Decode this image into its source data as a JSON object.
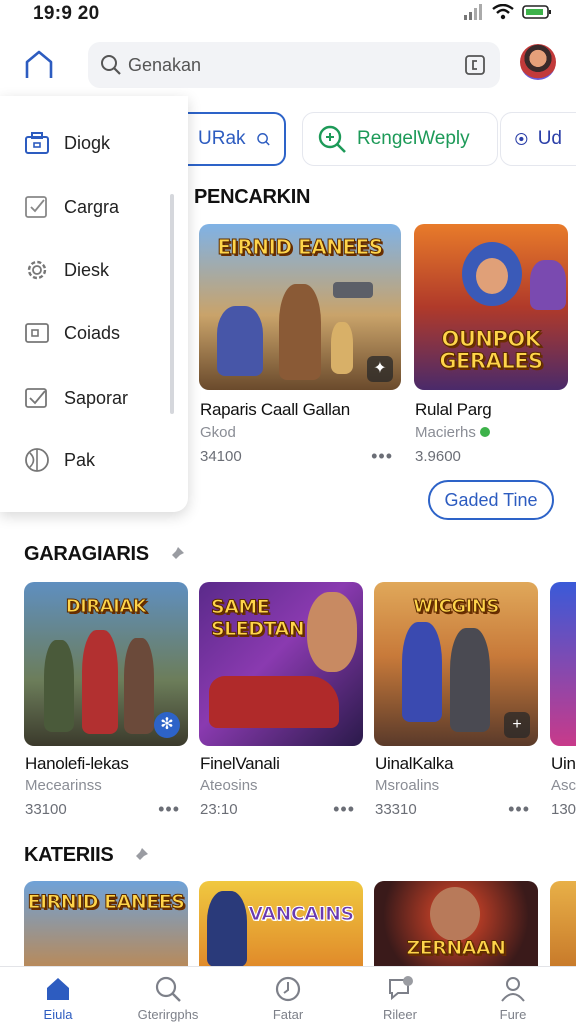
{
  "status_bar": {
    "time": "19:9 20"
  },
  "search": {
    "value": "Genakan"
  },
  "chips": [
    {
      "label": "URak"
    },
    {
      "label": "RengelWeply"
    },
    {
      "label": "Ud"
    }
  ],
  "menu": {
    "items": [
      {
        "label": "Diogk"
      },
      {
        "label": "Cargra"
      },
      {
        "label": "Diesk"
      },
      {
        "label": "Coiads"
      },
      {
        "label": "Saporar"
      },
      {
        "label": "Pak"
      }
    ]
  },
  "sections": {
    "s1": {
      "title": "PENCARKIN",
      "cards": [
        {
          "art": "EIRNID EANEES",
          "name": "Raparis Caall Gallan",
          "sub": "Gkod",
          "count": "34100"
        },
        {
          "art": "OUNPOK GERALES",
          "name": "Rulal Parg",
          "sub": "Macierhs",
          "count": "3.9600"
        }
      ],
      "guided_button": "Gaded Tine"
    },
    "s2": {
      "title": "GARAGIARIS",
      "cards": [
        {
          "art": "DIRAIAK",
          "name": "Hanolefi-lekas",
          "sub": "Mecearinss",
          "count": "33100"
        },
        {
          "art": "SAME SLEDTAN",
          "name": "FinelVanali",
          "sub": "Ateosins",
          "count": "23:10"
        },
        {
          "art": "WICGINS",
          "name": "UinalKalka",
          "sub": "Msroalins",
          "count": "33310"
        },
        {
          "art": "",
          "name": "Uin",
          "sub": "Asc",
          "count": "130"
        }
      ]
    },
    "s3": {
      "title": "KATERIIS",
      "cards": [
        {
          "art": "EIRNID EANEES"
        },
        {
          "art": "VANCAINS"
        },
        {
          "art": "ZERNAAN"
        },
        {
          "art": ""
        }
      ]
    }
  },
  "bottom_nav": [
    {
      "label": "Eiula",
      "active": true
    },
    {
      "label": "Gterirgphs",
      "active": false
    },
    {
      "label": "Fatar",
      "active": false
    },
    {
      "label": "Rileer",
      "active": false
    },
    {
      "label": "Fure",
      "active": false
    }
  ],
  "colors": {
    "accent": "#2d5cc0",
    "green": "#1d9a58"
  }
}
